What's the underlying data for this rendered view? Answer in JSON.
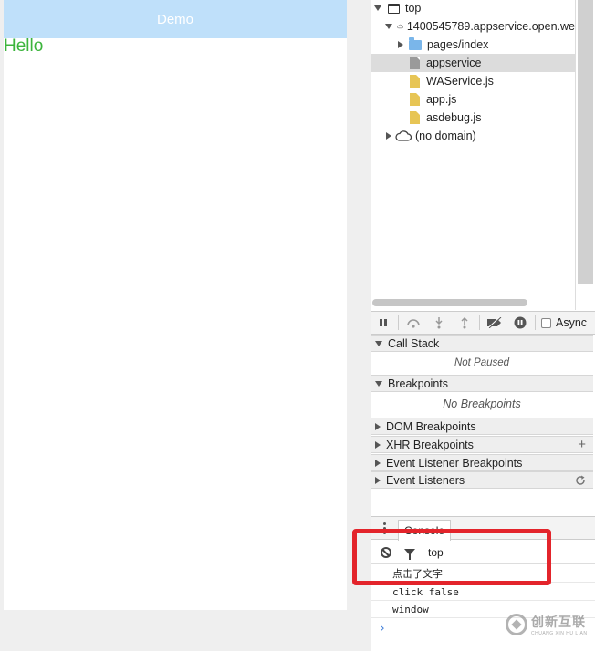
{
  "simulator": {
    "nav_title": "Demo",
    "hello_text": "Hello"
  },
  "sources_tree": [
    {
      "label": "top",
      "icon": "frame-icon",
      "expanded": true
    },
    {
      "label": "1400545789.appservice.open.we",
      "icon": "cloud-icon",
      "expanded": true
    },
    {
      "label": "pages/index",
      "icon": "folder-icon",
      "expanded": false
    },
    {
      "label": "appservice",
      "icon": "grey-file-icon",
      "selected": true
    },
    {
      "label": "WAService.js",
      "icon": "js-file-icon"
    },
    {
      "label": "app.js",
      "icon": "js-file-icon"
    },
    {
      "label": "asdebug.js",
      "icon": "js-file-icon"
    },
    {
      "label": "(no domain)",
      "icon": "cloud-icon",
      "expanded": false
    }
  ],
  "debugger": {
    "async_label": "Async",
    "call_stack": {
      "title": "Call Stack",
      "body": "Not Paused"
    },
    "breakpoints": {
      "title": "Breakpoints",
      "body": "No Breakpoints"
    },
    "dom_breakpoints": "DOM Breakpoints",
    "xhr_breakpoints": "XHR Breakpoints",
    "event_listener_breakpoints": "Event Listener Breakpoints",
    "event_listeners": "Event Listeners"
  },
  "console": {
    "tab_label": "Console",
    "context": "top",
    "lines": [
      "点击了文字",
      "click false",
      "window"
    ],
    "prompt": "›"
  },
  "watermark": {
    "cn": "创新互联",
    "en": "CHUANG XIN HU LIAN"
  },
  "colors": {
    "nav_bar": "#bfe0fa",
    "hello_text": "#3cb43c",
    "annotation_box": "#e3242b"
  }
}
